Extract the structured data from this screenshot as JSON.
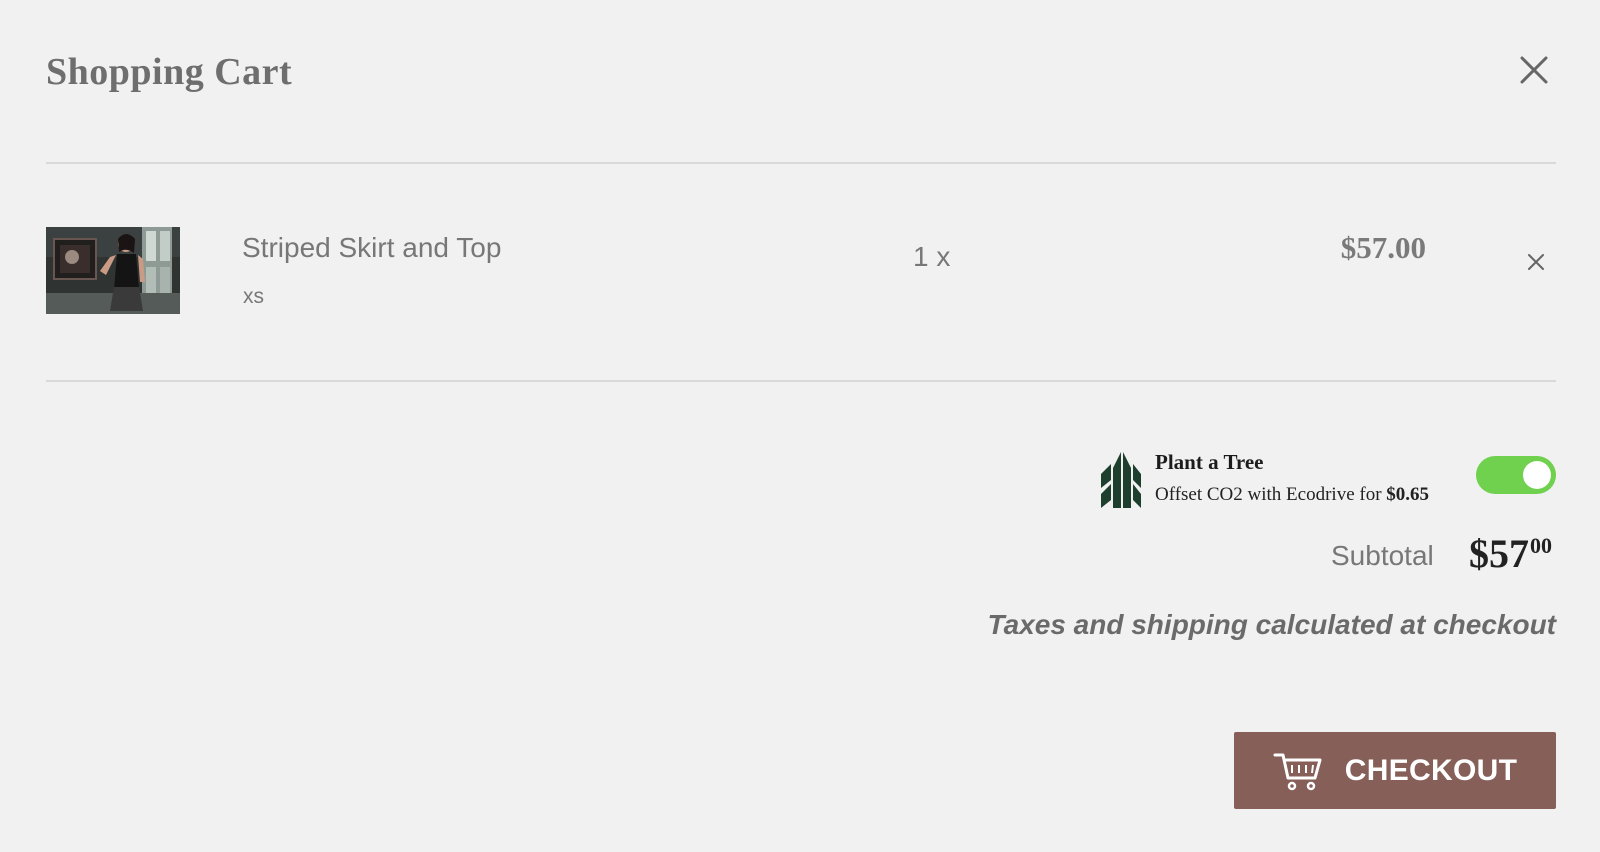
{
  "cart": {
    "title": "Shopping Cart",
    "close_icon": "close-icon"
  },
  "item": {
    "name": "Striped Skirt and Top",
    "variant": "xs",
    "quantity": "1 x",
    "price": "$57.00",
    "remove_icon": "close-icon",
    "image_icon": "product-photo"
  },
  "plant_tree": {
    "title": "Plant a Tree",
    "description": "Offset CO2 with Ecodrive for",
    "amount": "$0.65",
    "toggle_on": true,
    "icon": "tree-icon"
  },
  "summary": {
    "subtotal_label": "Subtotal",
    "subtotal_whole": "$57",
    "subtotal_cents": "00",
    "tax_note": "Taxes and shipping calculated at checkout"
  },
  "checkout": {
    "label": "CHECKOUT",
    "icon": "cart-icon"
  },
  "colors": {
    "background": "#f1f1f1",
    "checkout_button": "#875f59",
    "toggle_on": "#6fd14d",
    "tree_icon": "#1f3f2e"
  }
}
